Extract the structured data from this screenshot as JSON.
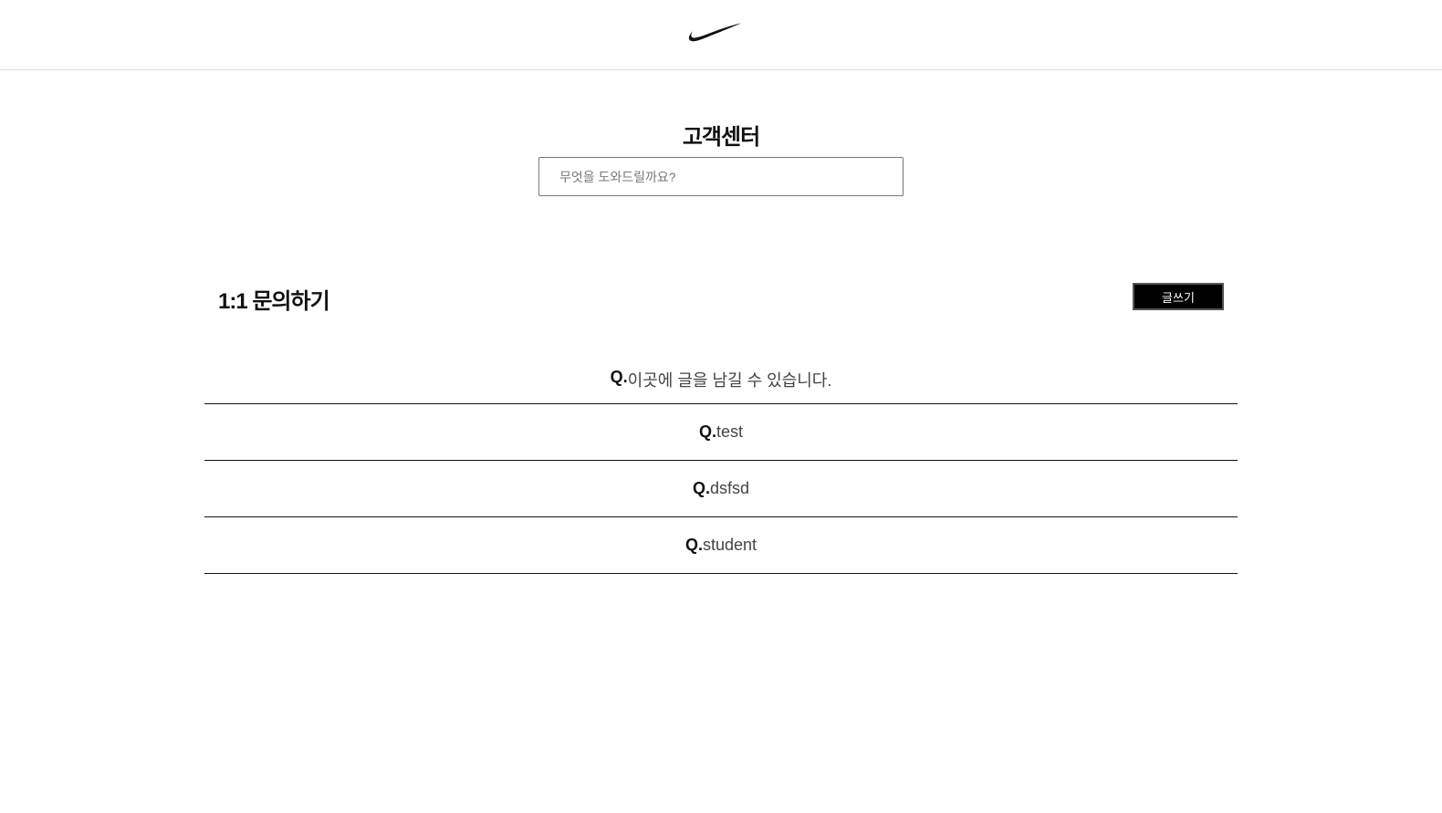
{
  "header": {
    "logo_name": "swoosh-logo"
  },
  "page": {
    "title": "고객센터"
  },
  "search": {
    "placeholder": "무엇을 도와드릴까요?",
    "value": ""
  },
  "inquiry": {
    "section_title": "1:1 문의하기",
    "write_button_label": "글쓰기",
    "question_prefix": "Q.",
    "items": [
      {
        "prefix": "Q.",
        "text": "이곳에 글을 남길 수 있습니다."
      },
      {
        "prefix": "Q.",
        "text": "test"
      },
      {
        "prefix": "Q.",
        "text": "dsfsd"
      },
      {
        "prefix": "Q.",
        "text": "student"
      }
    ]
  },
  "colors": {
    "background": "#ffffff",
    "button_bg": "#000000",
    "button_text": "#ffffff",
    "divider": "#111111"
  }
}
